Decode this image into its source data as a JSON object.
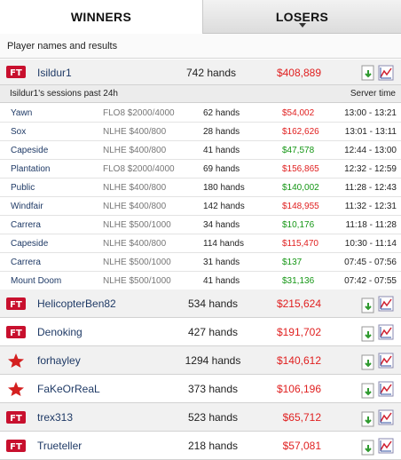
{
  "tabs": {
    "winners": "WINNERS",
    "losers": "LOSERS"
  },
  "results_header": "Player names and results",
  "top_player": {
    "name": "Isildur1",
    "hands": "742 hands",
    "amount": "$408,889",
    "network": "full-tilt"
  },
  "sessions": {
    "title": "Isildur1's sessions past 24h",
    "server_time_label": "Server time",
    "rows": [
      {
        "table": "Yawn",
        "game": "FLO8 $2000/4000",
        "hands": "62 hands",
        "amount": "$54,002",
        "sign": "neg",
        "time": "13:00 - 13:21"
      },
      {
        "table": "Sox",
        "game": "NLHE $400/800",
        "hands": "28 hands",
        "amount": "$162,626",
        "sign": "neg",
        "time": "13:01 - 13:11"
      },
      {
        "table": "Capeside",
        "game": "NLHE $400/800",
        "hands": "41 hands",
        "amount": "$47,578",
        "sign": "pos",
        "time": "12:44 - 13:00"
      },
      {
        "table": "Plantation",
        "game": "FLO8 $2000/4000",
        "hands": "69 hands",
        "amount": "$156,865",
        "sign": "neg",
        "time": "12:32 - 12:59"
      },
      {
        "table": "Public",
        "game": "NLHE $400/800",
        "hands": "180 hands",
        "amount": "$140,002",
        "sign": "pos",
        "time": "11:28 - 12:43"
      },
      {
        "table": "Windfair",
        "game": "NLHE $400/800",
        "hands": "142 hands",
        "amount": "$148,955",
        "sign": "neg",
        "time": "11:32 - 12:31"
      },
      {
        "table": "Carrera",
        "game": "NLHE $500/1000",
        "hands": "34 hands",
        "amount": "$10,176",
        "sign": "pos",
        "time": "11:18 - 11:28"
      },
      {
        "table": "Capeside",
        "game": "NLHE $400/800",
        "hands": "114 hands",
        "amount": "$115,470",
        "sign": "neg",
        "time": "10:30 - 11:14"
      },
      {
        "table": "Carrera",
        "game": "NLHE $500/1000",
        "hands": "31 hands",
        "amount": "$137",
        "sign": "pos",
        "time": "07:45 - 07:56"
      },
      {
        "table": "Mount Doom",
        "game": "NLHE $500/1000",
        "hands": "41 hands",
        "amount": "$31,136",
        "sign": "pos",
        "time": "07:42 - 07:55"
      }
    ]
  },
  "players": [
    {
      "name": "HelicopterBen82",
      "hands": "534 hands",
      "amount": "$215,624",
      "network": "full-tilt"
    },
    {
      "name": "Denoking",
      "hands": "427 hands",
      "amount": "$191,702",
      "network": "full-tilt"
    },
    {
      "name": "forhayley",
      "hands": "1294 hands",
      "amount": "$140,612",
      "network": "pokerstars"
    },
    {
      "name": "FaKeOrReaL",
      "hands": "373 hands",
      "amount": "$106,196",
      "network": "pokerstars"
    },
    {
      "name": "trex313",
      "hands": "523 hands",
      "amount": "$65,712",
      "network": "full-tilt"
    },
    {
      "name": "Trueteller",
      "hands": "218 hands",
      "amount": "$57,081",
      "network": "full-tilt"
    }
  ],
  "colors": {
    "loss": "#e02020",
    "win": "#149614",
    "link": "#1f3a66"
  },
  "icons": {
    "full_tilt": "full-tilt-logo-icon",
    "pokerstars": "pokerstars-logo-icon",
    "download": "download-icon",
    "graph": "graph-icon"
  }
}
